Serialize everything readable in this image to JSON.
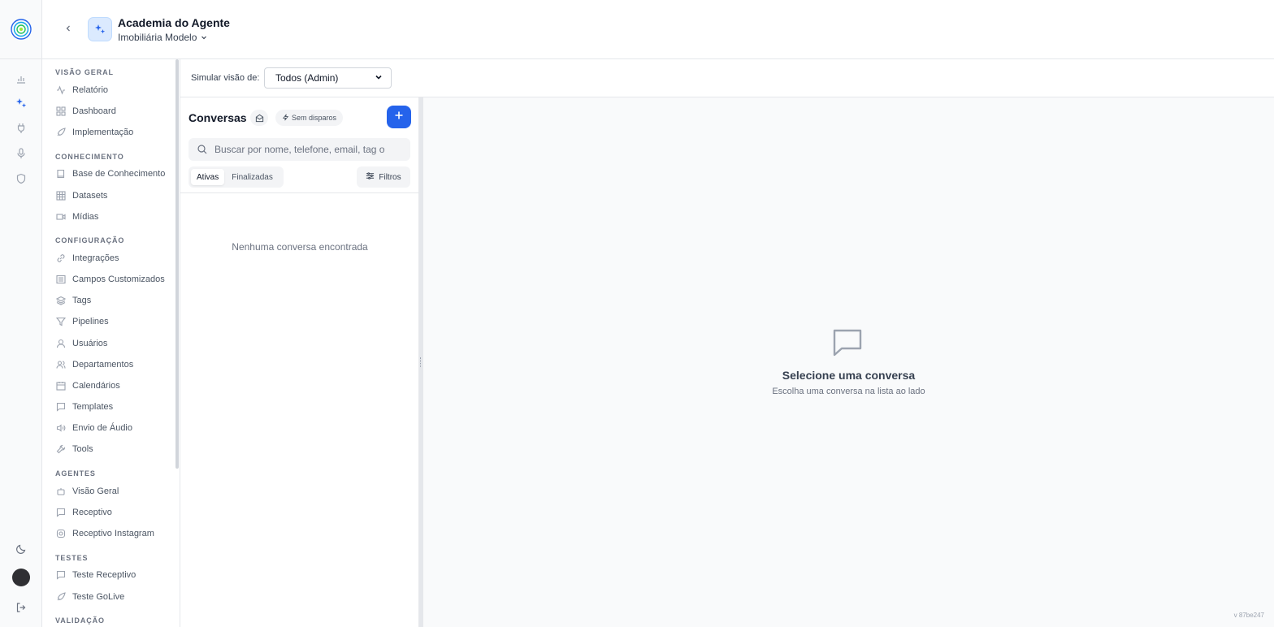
{
  "header": {
    "title": "Academia do Agente",
    "subtitle": "Imobiliária Modelo"
  },
  "sidebar": {
    "sections": {
      "overview": "VISÃO GERAL",
      "knowledge": "CONHECIMENTO",
      "config": "CONFIGURAÇÃO",
      "agents": "AGENTES",
      "tests": "TESTES",
      "validation": "VALIDAÇÃO"
    },
    "items": {
      "relatorio": "Relatório",
      "dashboard": "Dashboard",
      "implementacao": "Implementação",
      "base": "Base de Conhecimento",
      "datasets": "Datasets",
      "midias": "Mídias",
      "integracoes": "Integrações",
      "campos": "Campos Customizados",
      "tags": "Tags",
      "pipelines": "Pipelines",
      "usuarios": "Usuários",
      "departamentos": "Departamentos",
      "calendarios": "Calendários",
      "templates": "Templates",
      "audio": "Envio de Áudio",
      "tools": "Tools",
      "visao_geral": "Visão Geral",
      "receptivo": "Receptivo",
      "receptivo_instagram": "Receptivo Instagram",
      "teste_receptivo": "Teste Receptivo",
      "teste_golive": "Teste GoLive"
    }
  },
  "toolbar": {
    "simulate_label": "Simular visão de:",
    "simulate_value": "Todos (Admin)"
  },
  "conversations": {
    "title": "Conversas",
    "badge": "Sem disparos",
    "search_placeholder": "Buscar por nome, telefone, email, tag o",
    "tab_active": "Ativas",
    "tab_finished": "Finalizadas",
    "filters": "Filtros",
    "empty": "Nenhuma conversa encontrada"
  },
  "main": {
    "title": "Selecione uma conversa",
    "subtitle": "Escolha uma conversa na lista ao lado"
  },
  "version": "v 87be247",
  "colors": {
    "accent": "#2563eb",
    "border": "#e5e7eb",
    "muted": "#6b7280"
  }
}
